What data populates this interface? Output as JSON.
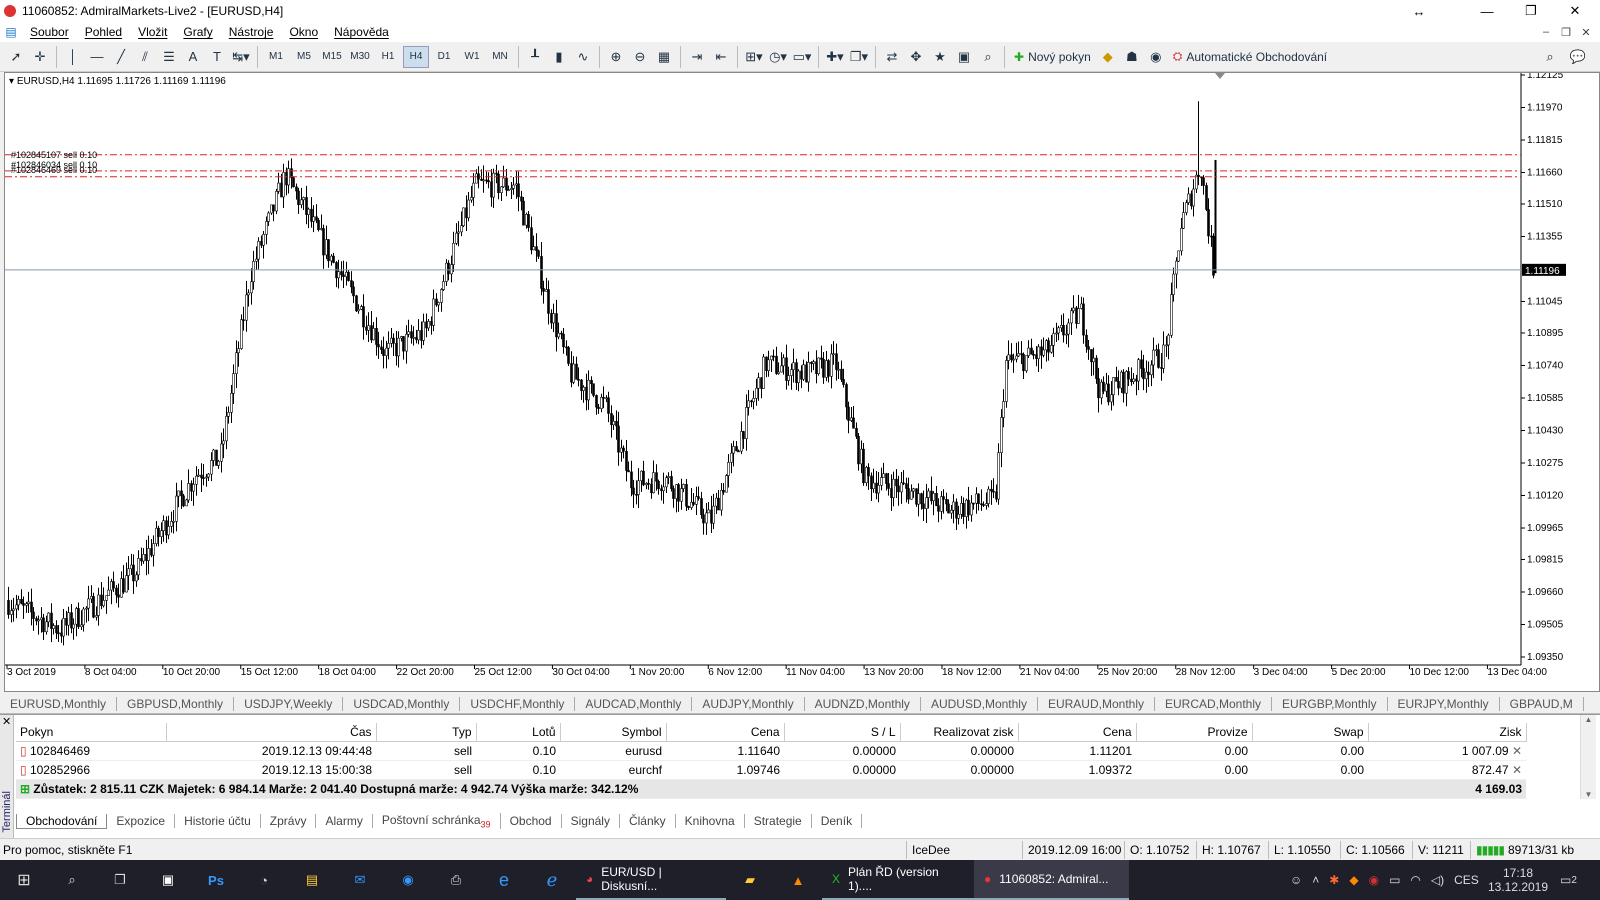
{
  "window": {
    "title": "11060852: AdmiralMarkets-Live2 - [EURUSD,H4]"
  },
  "menu": [
    "Soubor",
    "Pohled",
    "Vložit",
    "Grafy",
    "Nástroje",
    "Okno",
    "Nápověda"
  ],
  "toolbar": {
    "timeframes": [
      "M1",
      "M5",
      "M15",
      "M30",
      "H1",
      "H4",
      "D1",
      "W1",
      "MN"
    ],
    "selected_timeframe": "H4",
    "new_order": "Nový pokyn",
    "auto_trading": "Automatické Obchodování"
  },
  "chart": {
    "header": "EURUSD,H4  1.11695 1.11726 1.11169 1.11196",
    "current_price": "1.11196",
    "price_labels": [
      "1.12125",
      "1.11970",
      "1.11815",
      "1.11660",
      "1.11510",
      "1.11355",
      "1.11045",
      "1.10895",
      "1.10740",
      "1.10585",
      "1.10430",
      "1.10275",
      "1.10120",
      "1.09965",
      "1.09815",
      "1.09660",
      "1.09505",
      "1.09350"
    ],
    "time_labels": [
      "3 Oct 2019",
      "8 Oct 04:00",
      "10 Oct 20:00",
      "15 Oct 12:00",
      "18 Oct 04:00",
      "22 Oct 20:00",
      "25 Oct 12:00",
      "30 Oct 04:00",
      "1 Nov 20:00",
      "6 Nov 12:00",
      "11 Nov 04:00",
      "13 Nov 20:00",
      "18 Nov 12:00",
      "21 Nov 04:00",
      "25 Nov 20:00",
      "28 Nov 12:00",
      "3 Dec 04:00",
      "5 Dec 20:00",
      "10 Dec 12:00",
      "13 Dec 04:00"
    ],
    "order_labels": [
      "#102845107 sell 0.10",
      "#102846034 sell 0.10",
      "#102846469 sell 0.10"
    ],
    "order_line_color": "#e02020",
    "candle_color": "#000000"
  },
  "symbol_tabs": [
    "EURUSD,Monthly",
    "GBPUSD,Monthly",
    "USDJPY,Weekly",
    "USDCAD,Monthly",
    "USDCHF,Monthly",
    "AUDCAD,Monthly",
    "AUDJPY,Monthly",
    "AUDNZD,Monthly",
    "AUDUSD,Monthly",
    "EURAUD,Monthly",
    "EURCAD,Monthly",
    "EURGBP,Monthly",
    "EURJPY,Monthly",
    "GBPAUD,M"
  ],
  "terminal": {
    "side_label": "Terminál",
    "columns": [
      "Pokyn",
      "Čas",
      "Typ",
      "Lotů",
      "Symbol",
      "Cena",
      "S / L",
      "Realizovat zisk",
      "Cena",
      "Provize",
      "Swap",
      "Zisk"
    ],
    "rows": [
      {
        "ticket": "102846469",
        "time": "2019.12.13 09:44:48",
        "type": "sell",
        "lots": "0.10",
        "symbol": "eurusd",
        "price": "1.11640",
        "sl": "0.00000",
        "tp": "0.00000",
        "cur": "1.11201",
        "commission": "0.00",
        "swap": "0.00",
        "profit": "1 007.09"
      },
      {
        "ticket": "102852966",
        "time": "2019.12.13 15:00:38",
        "type": "sell",
        "lots": "0.10",
        "symbol": "eurchf",
        "price": "1.09746",
        "sl": "0.00000",
        "tp": "0.00000",
        "cur": "1.09372",
        "commission": "0.00",
        "swap": "0.00",
        "profit": "872.47"
      }
    ],
    "balance_text": "Zůstatek: 2 815.11 CZK  Majetek: 6 984.14  Marže: 2 041.40  Dostupná marže: 4 942.74  Výška marže: 342.12%",
    "total_profit": "4 169.03",
    "tabs": [
      "Obchodování",
      "Expozice",
      "Historie účtu",
      "Zprávy",
      "Alarmy",
      "Poštovní schránka",
      "Obchod",
      "Signály",
      "Články",
      "Knihovna",
      "Strategie",
      "Deník"
    ],
    "mailbox_count": "39",
    "active_tab": "Obchodování"
  },
  "status": {
    "help": "Pro pomoc, stiskněte F1",
    "profile": "IceDee",
    "datetime": "2019.12.09 16:00",
    "open": "O: 1.10752",
    "high": "H: 1.10767",
    "low": "L: 1.10550",
    "close": "C: 1.10566",
    "volume": "V: 11211",
    "traffic": "89713/31 kb"
  },
  "taskbar": {
    "apps": [
      "EUR/USD | Diskusní...",
      "Plán ŘD (version 1)....",
      "11060852: Admiral..."
    ],
    "lang": "CES",
    "time": "17:18",
    "date": "13.12.2019",
    "notif": "2"
  }
}
